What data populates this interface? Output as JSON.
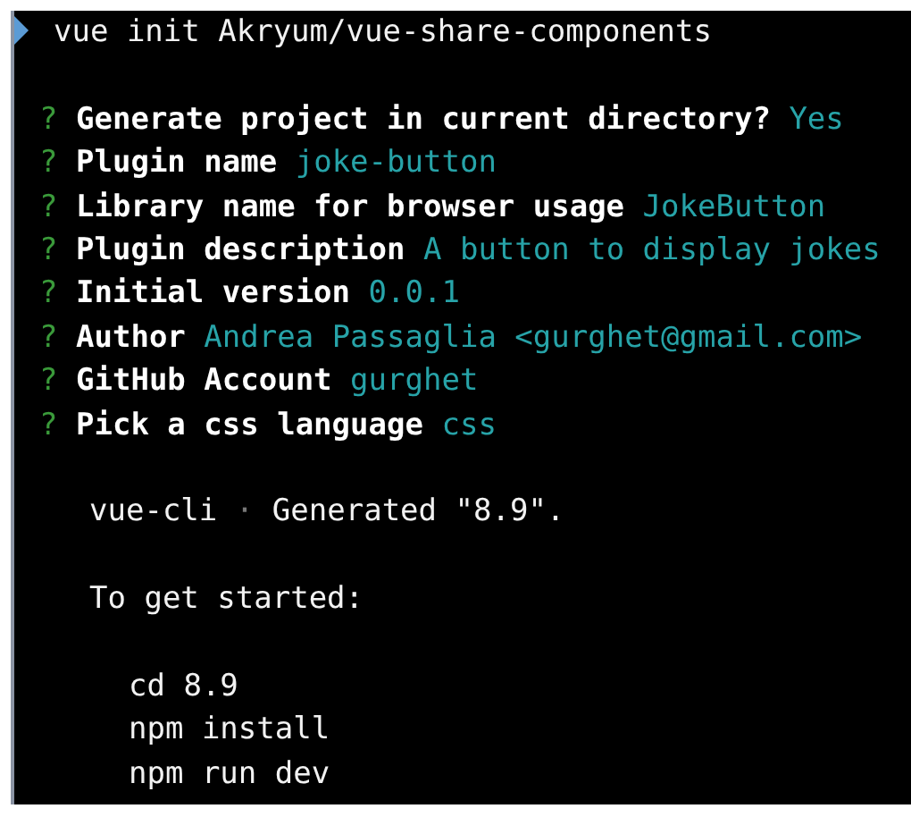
{
  "command": "vue init Akryum/vue-share-components",
  "prompts": [
    {
      "marker": "?",
      "question": "Generate project in current directory?",
      "answer": "Yes"
    },
    {
      "marker": "?",
      "question": "Plugin name",
      "answer": "joke-button"
    },
    {
      "marker": "?",
      "question": "Library name for browser usage",
      "answer": "JokeButton"
    },
    {
      "marker": "?",
      "question": "Plugin description",
      "answer": "A button to display jokes"
    },
    {
      "marker": "?",
      "question": "Initial version",
      "answer": "0.0.1"
    },
    {
      "marker": "?",
      "question": "Author",
      "answer": "Andrea Passaglia <gurghet@gmail.com>"
    },
    {
      "marker": "?",
      "question": "GitHub Account",
      "answer": "gurghet"
    },
    {
      "marker": "?",
      "question": "Pick a css language",
      "answer": "css"
    }
  ],
  "log": {
    "source": "vue-cli",
    "separator": "·",
    "message": "Generated \"8.9\"."
  },
  "next_steps": {
    "heading": "To get started:",
    "commands": [
      "cd 8.9",
      "npm install",
      "npm run dev"
    ]
  }
}
